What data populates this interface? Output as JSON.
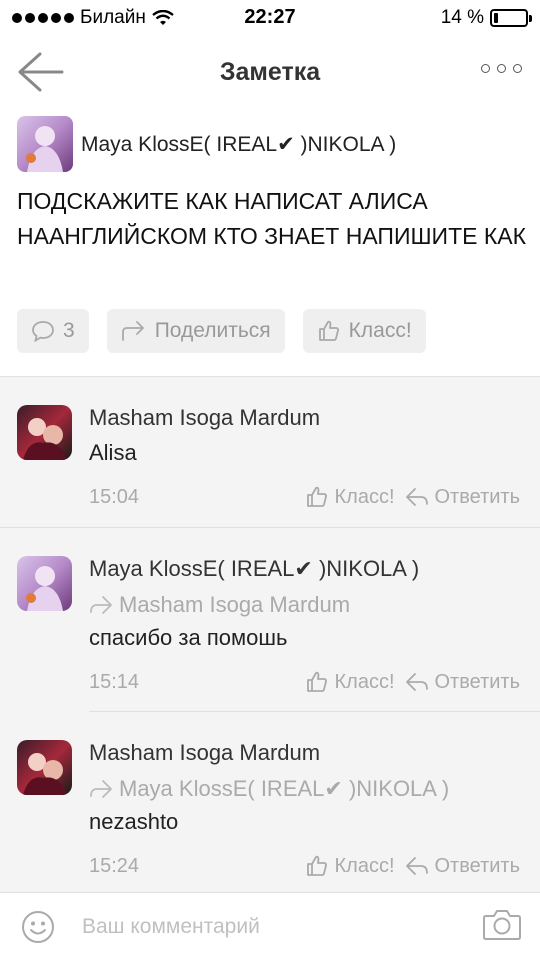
{
  "status_bar": {
    "carrier": "Билайн",
    "time": "22:27",
    "battery_text": "14 %",
    "battery_level": 0.14
  },
  "nav": {
    "title": "Заметка",
    "back_icon": "back-arrow-icon",
    "more_icon": "more-dots-icon"
  },
  "post": {
    "author": "Maya KlossE( IREAL✔ )NIKOLA )",
    "text": "ПОДСКАЖИТЕ КАК НАПИСАТ АЛИСА НААНГЛИЙСКОМ КТО ЗНАЕТ НАПИШИТЕ КАК",
    "comments_count": "3",
    "share_label": "Поделиться",
    "like_label": "Класс!"
  },
  "comments": [
    {
      "author": "Masham Isoga Mardum",
      "reply_to": "",
      "text": "Alisa",
      "time": "15:04",
      "like_label": "Класс!",
      "reply_label": "Ответить"
    },
    {
      "author": "Maya KlossE( IREAL✔ )NIKOLA )",
      "reply_to": "Masham Isoga Mardum",
      "text": "спасибо за помошь",
      "time": "15:14",
      "like_label": "Класс!",
      "reply_label": "Ответить"
    },
    {
      "author": "Masham Isoga Mardum",
      "reply_to": "Maya KlossE( IREAL✔ )NIKOLA )",
      "text": "nezashto",
      "time": "15:24",
      "like_label": "Класс!",
      "reply_label": "Ответить"
    }
  ],
  "input": {
    "placeholder": "Ваш комментарий",
    "value": ""
  },
  "colors": {
    "muted_text": "#aaaaaa",
    "comments_bg": "#f4f4f4",
    "pill_bg": "#efefef"
  }
}
